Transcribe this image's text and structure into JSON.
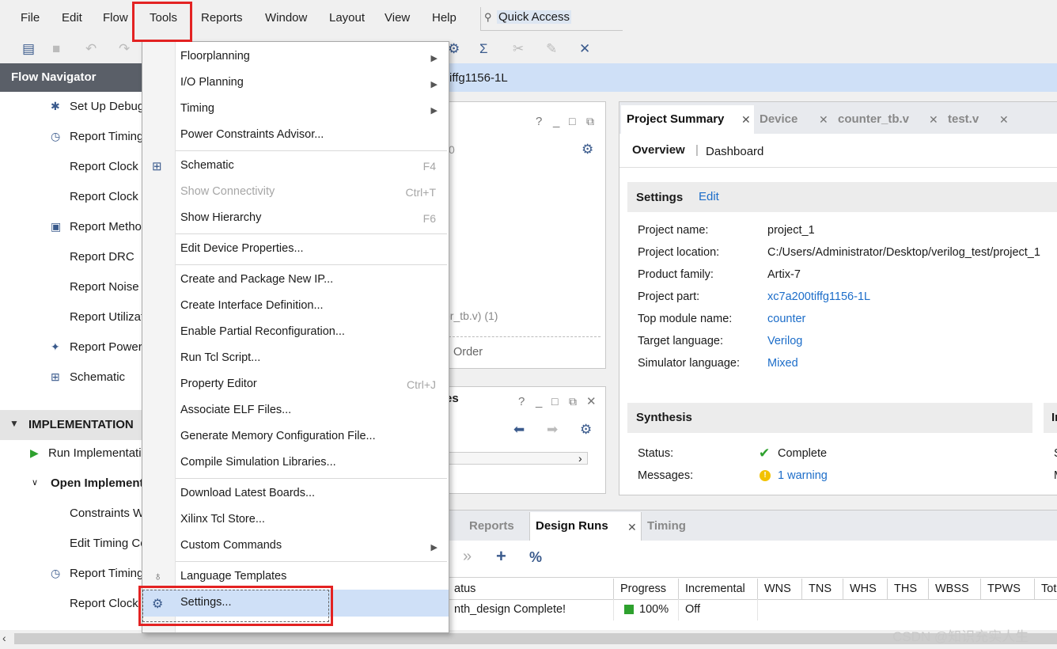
{
  "menubar": {
    "items": [
      "File",
      "Edit",
      "Flow",
      "Tools",
      "Reports",
      "Window",
      "Layout",
      "View",
      "Help"
    ],
    "quick_access": "Quick Access"
  },
  "flow_navigator": {
    "title": "Flow Navigator",
    "items": [
      "Set Up Debug",
      "Report Timing",
      "Report Clock I",
      "Report Clock I",
      "Report Method",
      "Report DRC",
      "Report Noise",
      "Report Utilizat",
      "Report Power",
      "Schematic"
    ],
    "impl_section": "IMPLEMENTATION",
    "impl_items": [
      "Run Implementatio",
      "Open Implement",
      "Constraints W",
      "Edit Timing Co",
      "Report Timing",
      "Report Clock"
    ]
  },
  "banner": {
    "text": "iffg1156-1L"
  },
  "left_panel": {
    "partial_text1": "0",
    "partial_text2": "er_tb.v) (1)",
    "partial_text3": "Order",
    "partial_title": "es"
  },
  "project_summary": {
    "tabs": [
      "Project Summary",
      "Device",
      "counter_tb.v",
      "test.v"
    ],
    "subtabs": [
      "Overview",
      "Dashboard"
    ],
    "settings_title": "Settings",
    "edit": "Edit",
    "fields": [
      {
        "label": "Project name:",
        "value": "project_1"
      },
      {
        "label": "Project location:",
        "value": "C:/Users/Administrator/Desktop/verilog_test/project_1"
      },
      {
        "label": "Product family:",
        "value": "Artix-7"
      },
      {
        "label": "Project part:",
        "value": "xc7a200tiffg1156-1L"
      },
      {
        "label": "Top module name:",
        "value": "counter"
      },
      {
        "label": "Target language:",
        "value": "Verilog"
      },
      {
        "label": "Simulator language:",
        "value": "Mixed"
      }
    ],
    "synthesis_title": "Synthesis",
    "impl_title_partial": "In",
    "status_label": "Status:",
    "status_value": "Complete",
    "messages_label": "Messages:",
    "messages_value": "1 warning",
    "right_partial_s": "S",
    "right_partial_m": "M"
  },
  "bottom": {
    "tabs": [
      "Reports",
      "Design Runs",
      "Timing"
    ],
    "toolbar": [
      "»",
      "+",
      "%"
    ],
    "columns": [
      "atus",
      "Progress",
      "Incremental",
      "WNS",
      "TNS",
      "WHS",
      "THS",
      "WBSS",
      "TPWS",
      "Tot"
    ],
    "row": {
      "status": "nth_design Complete!",
      "progress": "100%",
      "incremental": "Off"
    }
  },
  "tools_menu": {
    "items": [
      {
        "label": "Floorplanning",
        "submenu": true
      },
      {
        "label": "I/O Planning",
        "submenu": true
      },
      {
        "label": "Timing",
        "submenu": true
      },
      {
        "label": "Power Constraints Advisor..."
      },
      {
        "label": "Schematic",
        "shortcut": "F4"
      },
      {
        "label": "Show Connectivity",
        "shortcut": "Ctrl+T",
        "disabled": true
      },
      {
        "label": "Show Hierarchy",
        "shortcut": "F6"
      },
      {
        "label": "Edit Device Properties..."
      },
      {
        "label": "Create and Package New IP..."
      },
      {
        "label": "Create Interface Definition..."
      },
      {
        "label": "Enable Partial Reconfiguration..."
      },
      {
        "label": "Run Tcl Script..."
      },
      {
        "label": "Property Editor",
        "shortcut": "Ctrl+J"
      },
      {
        "label": "Associate ELF Files..."
      },
      {
        "label": "Generate Memory Configuration File..."
      },
      {
        "label": "Compile Simulation Libraries..."
      },
      {
        "label": "Download Latest Boards..."
      },
      {
        "label": "Xilinx Tcl Store..."
      },
      {
        "label": "Custom Commands",
        "submenu": true
      },
      {
        "label": "Language Templates"
      },
      {
        "label": "Settings..."
      }
    ]
  },
  "watermark": "CSDN @知识充实人生",
  "colors": {
    "highlight_red": "#e32222",
    "selection_blue": "#cfe0f7",
    "link_blue": "#1c6dc9",
    "nav_header": "#5a5f68"
  }
}
